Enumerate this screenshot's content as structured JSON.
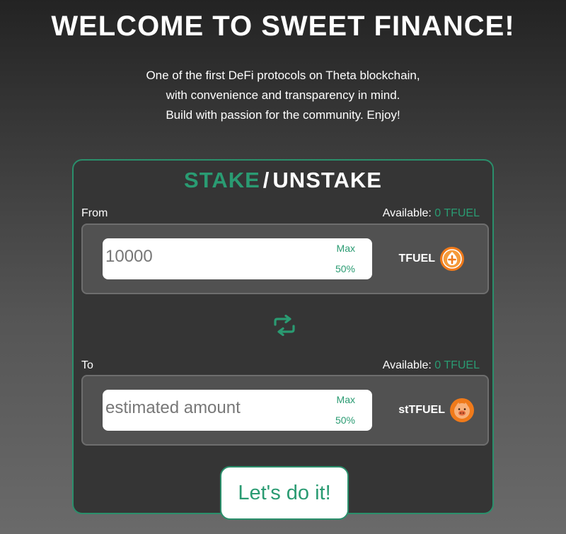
{
  "header": {
    "title": "WELCOME TO SWEET FINANCE!",
    "intro_lines": [
      "One of the first DeFi protocols on Theta blockchain,",
      "with convenience and transparency in mind.",
      "Build with passion for the community. Enjoy!"
    ]
  },
  "card": {
    "tabs": {
      "stake": "STAKE",
      "separator": "/",
      "unstake": "UNSTAKE",
      "active": "stake"
    },
    "from": {
      "label": "From",
      "available_label": "Available:",
      "available_value": "0 TFUEL",
      "amount_value": "10000",
      "amount_placeholder": "",
      "max_label": "Max",
      "half_label": "50%",
      "token": "TFUEL",
      "token_icon": "tfuel-coin-icon"
    },
    "swap_icon": "swap-arrows-icon",
    "to": {
      "label": "To",
      "available_label": "Available:",
      "available_value": "0 TFUEL",
      "amount_value": "",
      "amount_placeholder": "estimated amount",
      "max_label": "Max",
      "half_label": "50%",
      "token": "stTFUEL",
      "token_icon": "sttfuel-piggy-icon"
    },
    "submit_label": "Let's do it!"
  },
  "colors": {
    "accent": "#2a9b72",
    "card_bg": "#353535",
    "token_orange": "#f07a1a"
  }
}
